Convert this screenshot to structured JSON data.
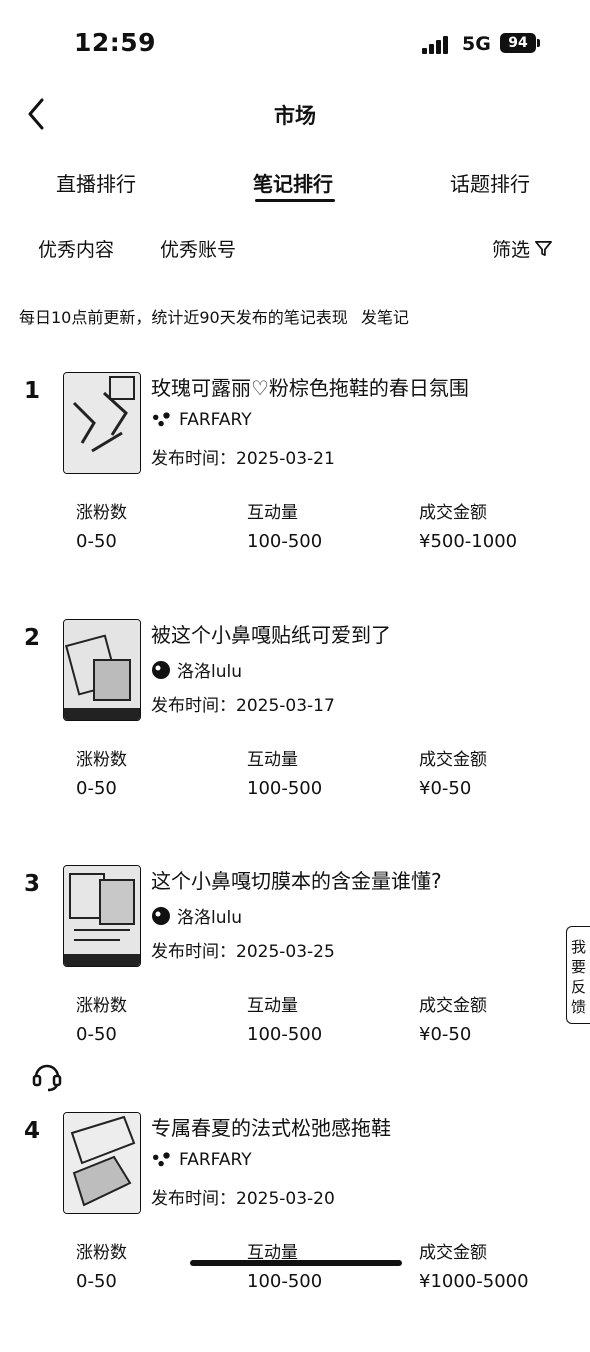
{
  "status_bar": {
    "time": "12:59",
    "network": "5G",
    "battery": "94"
  },
  "nav": {
    "title": "市场"
  },
  "tabs": [
    {
      "label": "直播排行",
      "active": false
    },
    {
      "label": "笔记排行",
      "active": true
    },
    {
      "label": "话题排行",
      "active": false
    }
  ],
  "subtabs": [
    {
      "label": "优秀内容"
    },
    {
      "label": "优秀账号"
    }
  ],
  "filter": {
    "label": "筛选"
  },
  "notice": {
    "text": "每日10点前更新，统计近90天发布的笔记表现",
    "link": "发笔记"
  },
  "stat_labels": {
    "fans": "涨粉数",
    "interaction": "互动量",
    "gmv": "成交金额"
  },
  "date_prefix": "发布时间：",
  "items": [
    {
      "rank": "1",
      "title": "玫瑰可露丽♡粉棕色拖鞋的春日氛围",
      "author": "FARFARY",
      "date": "2025-03-21",
      "fans": "0-50",
      "interaction": "100-500",
      "gmv": "¥500-1000"
    },
    {
      "rank": "2",
      "title": "被这个小鼻嘎贴纸可爱到了",
      "author": "洛洛lulu",
      "date": "2025-03-17",
      "fans": "0-50",
      "interaction": "100-500",
      "gmv": "¥0-50"
    },
    {
      "rank": "3",
      "title": "这个小鼻嘎切膜本的含金量谁懂?",
      "author": "洛洛lulu",
      "date": "2025-03-25",
      "fans": "0-50",
      "interaction": "100-500",
      "gmv": "¥0-50"
    },
    {
      "rank": "4",
      "title": "专属春夏的法式松弛感拖鞋",
      "author": "FARFARY",
      "date": "2025-03-20",
      "fans": "0-50",
      "interaction": "100-500",
      "gmv": "¥1000-5000"
    }
  ],
  "feedback": {
    "label": "我要反馈"
  },
  "icons": {
    "back": "chevron-left-icon",
    "filter": "funnel-icon",
    "support": "headset-icon"
  }
}
